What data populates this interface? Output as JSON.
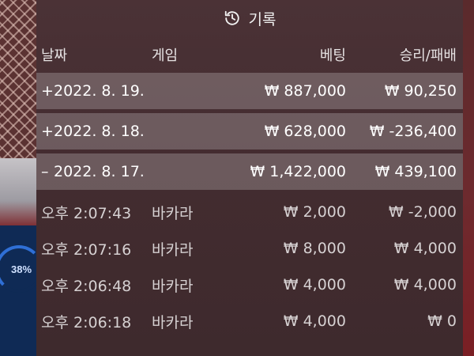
{
  "panel": {
    "title": "기록",
    "columns": {
      "date": "날짜",
      "game": "게임",
      "bet": "베팅",
      "result": "승리/패배"
    }
  },
  "day_rows": [
    {
      "toggle": "+",
      "date": "2022. 8. 19.",
      "bet": "₩ 887,000",
      "result": "₩ 90,250"
    },
    {
      "toggle": "+",
      "date": "2022. 8. 18.",
      "bet": "₩ 628,000",
      "result": "₩ -236,400"
    },
    {
      "toggle": "–",
      "date": "2022. 8. 17.",
      "bet": "₩ 1,422,000",
      "result": "₩ 439,100"
    }
  ],
  "detail_rows": [
    {
      "time": "오후 2:07:43",
      "game": "바카라",
      "bet": "₩ 2,000",
      "result": "₩ -2,000"
    },
    {
      "time": "오후 2:07:16",
      "game": "바카라",
      "bet": "₩ 8,000",
      "result": "₩ 4,000"
    },
    {
      "time": "오후 2:06:48",
      "game": "바카라",
      "bet": "₩ 4,000",
      "result": "₩ 4,000"
    },
    {
      "time": "오후 2:06:18",
      "game": "바카라",
      "bet": "₩ 4,000",
      "result": "₩ 0"
    }
  ],
  "background": {
    "progress_label": "38%",
    "progress_fraction": 0.38
  },
  "colors": {
    "day_row_bg": "#7a6568",
    "panel_bg": "#4b3236",
    "progress_accent": "#2f6fd6"
  },
  "icons": {
    "header": "history-icon"
  }
}
